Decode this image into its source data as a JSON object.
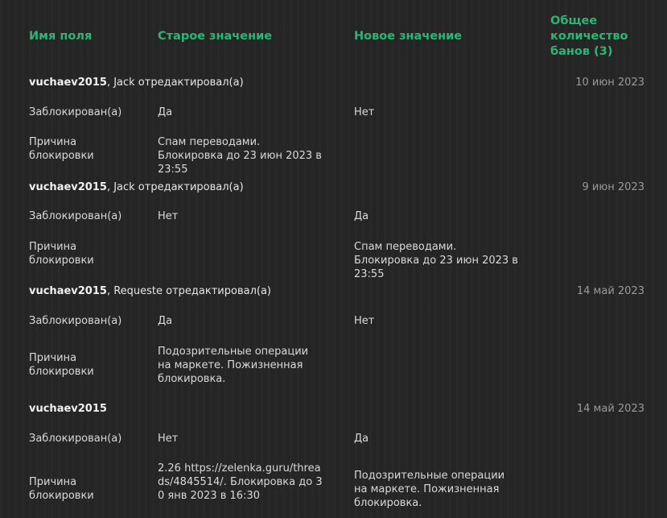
{
  "header": {
    "field": "Имя поля",
    "old": "Старое значение",
    "new": "Новое значение",
    "total": "Общее количество банов (3)"
  },
  "groups": [
    {
      "user": "vuchaev2015",
      "action": ", Jack отредактировал(а)",
      "date": "10 июн 2023",
      "rows": [
        {
          "field": "Заблокирован(а)",
          "old": "Да",
          "new": "Нет"
        },
        {
          "field": "Причина блокировки",
          "old": "Спам переводами. Блокировка до 23 июн 2023 в 23:55",
          "new": ""
        }
      ]
    },
    {
      "user": "vuchaev2015",
      "action": ", Jack отредактировал(а)",
      "date": "9 июн 2023",
      "rows": [
        {
          "field": "Заблокирован(а)",
          "old": "Нет",
          "new": "Да"
        },
        {
          "field": "Причина блокировки",
          "old": "",
          "new": "Спам переводами. Блокировка до 23 июн 2023 в 23:55"
        }
      ]
    },
    {
      "user": "vuchaev2015",
      "action": ", Requeste отредактировал(а)",
      "date": "14 май 2023",
      "rows": [
        {
          "field": "Заблокирован(а)",
          "old": "Да",
          "new": "Нет"
        },
        {
          "field": "Причина блокировки",
          "old": "Подозрительные операции на маркете. Пожизненная блокировка.",
          "new": ""
        }
      ]
    },
    {
      "user": "vuchaev2015",
      "action": "",
      "date": "14 май 2023",
      "rows": [
        {
          "field": "Заблокирован(а)",
          "old": "Нет",
          "new": "Да"
        },
        {
          "field": "Причина блокировки",
          "old": "2.26 https://zelenka.guru/threads/4845514/. Блокировка до 30 янв 2023 в 16:30",
          "new": "Подозрительные операции на маркете. Пожизненная блокировка."
        }
      ]
    }
  ]
}
